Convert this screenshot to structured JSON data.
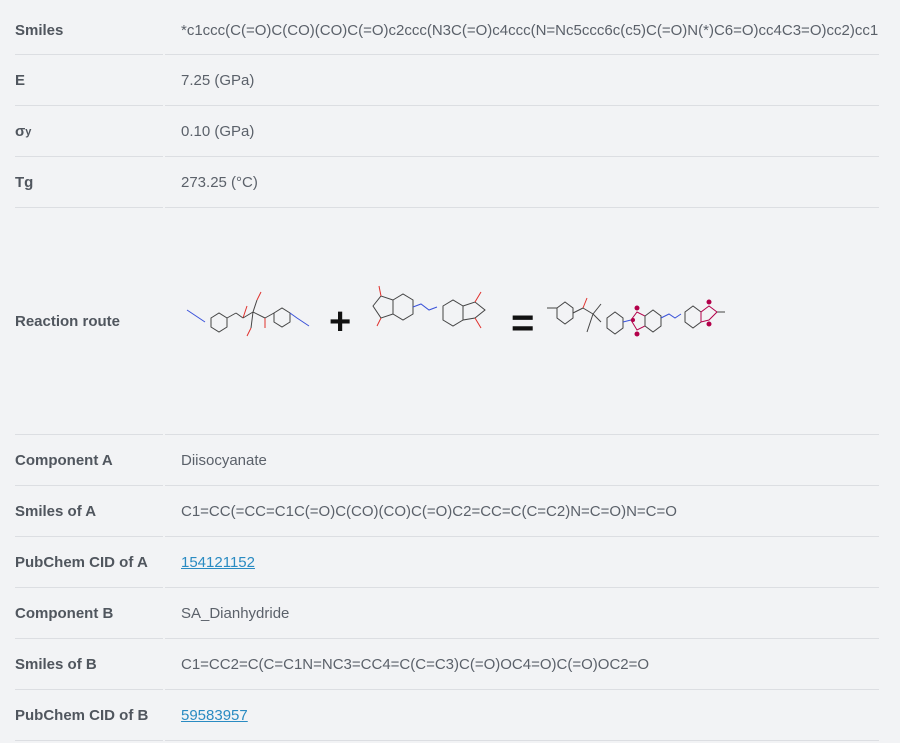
{
  "rows": {
    "smiles": {
      "label": "Smiles",
      "value": "*c1ccc(C(=O)C(CO)(CO)C(=O)c2ccc(N3C(=O)c4ccc(N=Nc5ccc6c(c5)C(=O)N(*)C6=O)cc4C3=O)cc2)cc1"
    },
    "e": {
      "label": "E",
      "value": "7.25 (GPa)"
    },
    "sigma_y": {
      "label_main": "σ",
      "label_sub": "y",
      "value": "0.10 (GPa)"
    },
    "tg": {
      "label": "Tg",
      "value": "273.25 (°C)"
    },
    "reaction_route": {
      "label": "Reaction route",
      "plus": "+",
      "equals": "="
    },
    "component_a": {
      "label": "Component A",
      "value": "Diisocyanate"
    },
    "smiles_a": {
      "label": "Smiles of A",
      "value": "C1=CC(=CC=C1C(=O)C(CO)(CO)C(=O)C2=CC=C(C=C2)N=C=O)N=C=O"
    },
    "pubchem_a": {
      "label": "PubChem CID of A",
      "value": "154121152"
    },
    "component_b": {
      "label": "Component B",
      "value": "SA_Dianhydride"
    },
    "smiles_b": {
      "label": "Smiles of B",
      "value": "C1=CC2=C(C=C1N=NC3=CC4=C(C=C3)C(=O)OC4=O)C(=O)OC2=O"
    },
    "pubchem_b": {
      "label": "PubChem CID of B",
      "value": "59583957"
    }
  },
  "colors": {
    "background": "#f2f3f5",
    "link": "#2a8bc2",
    "oxygen_atom": "#e0302c",
    "nitrogen_atom": "#3a52d9",
    "polymer_oxygen": "#b3004a"
  }
}
